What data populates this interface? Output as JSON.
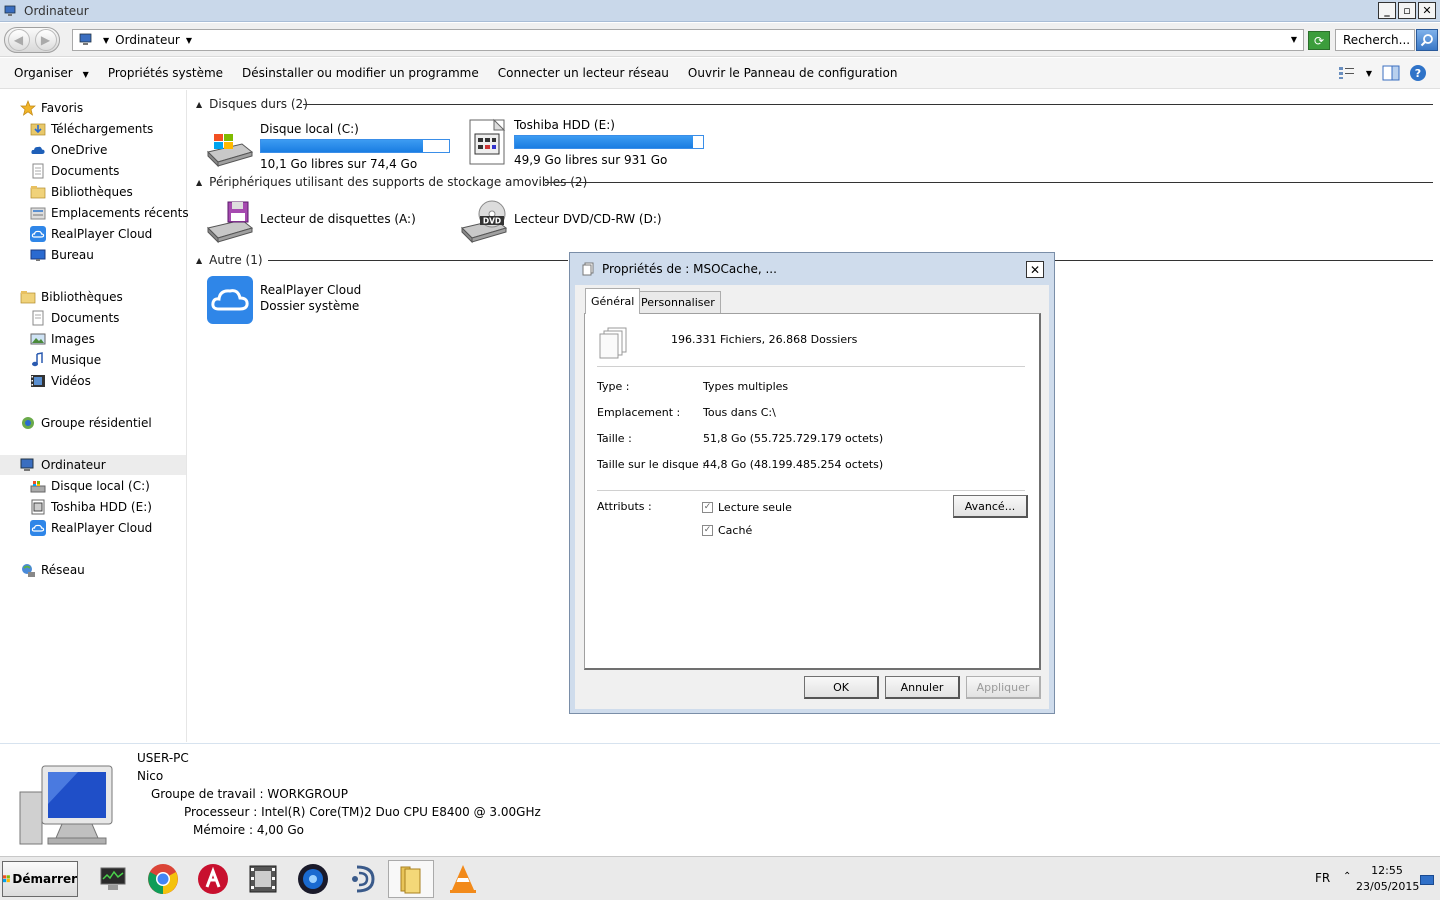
{
  "window": {
    "title": "Ordinateur",
    "minimize": "_",
    "maximize": "▫",
    "close": "✕"
  },
  "address": {
    "crumb": "Ordinateur",
    "search_placeholder": "Recherch..."
  },
  "commands": [
    {
      "label": "Organiser",
      "has_dropdown": true
    },
    {
      "label": "Propriétés système"
    },
    {
      "label": "Désinstaller ou modifier un programme"
    },
    {
      "label": "Connecter un lecteur réseau"
    },
    {
      "label": "Ouvrir le Panneau de configuration"
    }
  ],
  "nav": {
    "favorites": "Favoris",
    "fav_items": [
      "Téléchargements",
      "OneDrive",
      "Documents",
      "Bibliothèques",
      "Emplacements récents",
      "RealPlayer Cloud",
      "Bureau"
    ],
    "libraries": "Bibliothèques",
    "lib_items": [
      "Documents",
      "Images",
      "Musique",
      "Vidéos"
    ],
    "homegroup": "Groupe résidentiel",
    "computer": "Ordinateur",
    "comp_items": [
      "Disque local (C:)",
      "Toshiba HDD (E:)",
      "RealPlayer Cloud"
    ],
    "network": "Réseau"
  },
  "groups": {
    "hard_disks": "Disques durs  (2)",
    "removable": "Périphériques utilisant des supports de stockage amovibles  (2)",
    "other": "Autre  (1)"
  },
  "drives": {
    "c": {
      "name": "Disque local (C:)",
      "free": "10,1 Go libres sur 74,4 Go",
      "used_fraction": 0.864
    },
    "e": {
      "name": "Toshiba HDD (E:)",
      "free": "49,9 Go libres sur 931 Go",
      "used_fraction": 0.946
    },
    "a": {
      "name": "Lecteur de disquettes (A:)"
    },
    "d": {
      "name": "Lecteur DVD/CD-RW (D:)",
      "dvd_label": "DVD"
    },
    "cloud": {
      "name": "RealPlayer Cloud",
      "sub": "Dossier système"
    }
  },
  "details": {
    "pc_name": "USER-PC",
    "user": "Nico",
    "workgroup": "Groupe de travail :  WORKGROUP",
    "processor": "Processeur :  Intel(R) Core(TM)2 Duo CPU     E8400  @ 3.00GHz",
    "memory": "Mémoire :  4,00 Go"
  },
  "taskbar": {
    "start": "Démarrer",
    "lang": "FR",
    "time": "12:55",
    "date": "23/05/2015",
    "tray_arrow": "⌃"
  },
  "dialog": {
    "title": "Propriétés de : MSOCache, ...",
    "tabs": [
      "Général",
      "Personnaliser"
    ],
    "summary": "196.331 Fichiers, 26.868 Dossiers",
    "type_label": "Type :",
    "type_value": "Types multiples",
    "location_label": "Emplacement :",
    "location_value": "Tous dans C:\\",
    "size_label": "Taille :",
    "size_value": "51,8 Go (55.725.729.179 octets)",
    "disk_size_label": "Taille sur le disque :",
    "disk_size_value": "44,8 Go (48.199.485.254 octets)",
    "attributes_label": "Attributs :",
    "readonly_label": "Lecture seule",
    "hidden_label": "Caché",
    "readonly_checked": true,
    "hidden_checked": true,
    "advanced_button": "Avancé...",
    "ok": "OK",
    "cancel": "Annuler",
    "apply": "Appliquer"
  },
  "colors": {
    "accent": "#2f86e8",
    "titlebar": "#c9d8ea",
    "dialog_frame": "#cfdcec"
  }
}
